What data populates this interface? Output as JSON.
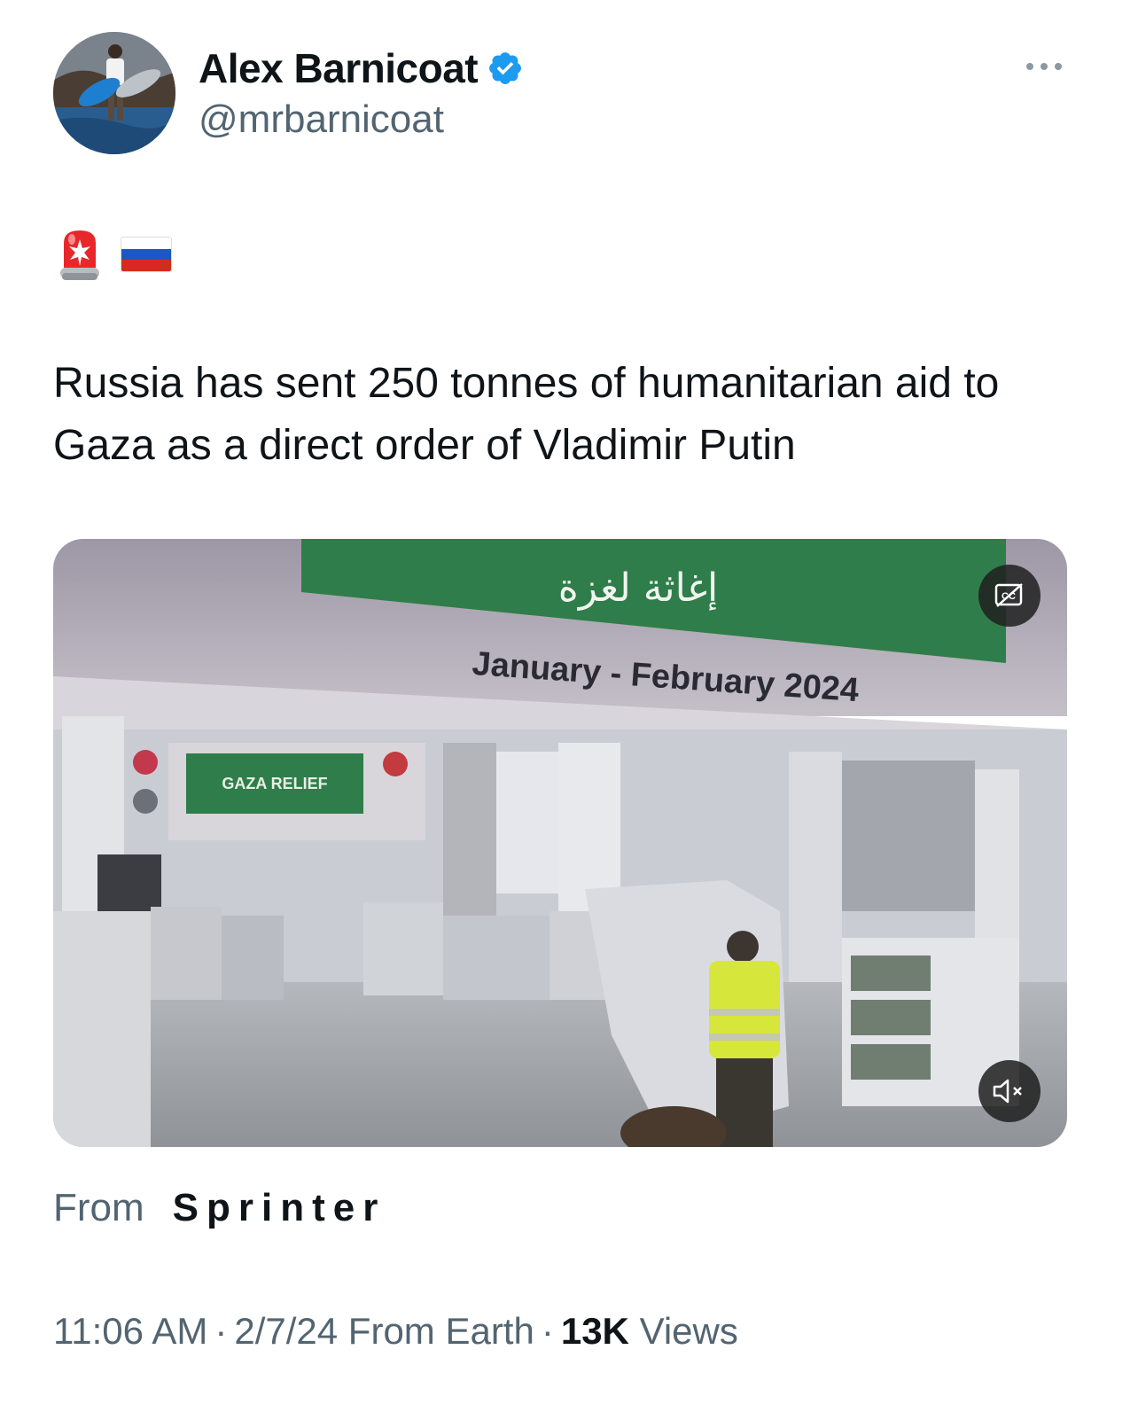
{
  "author": {
    "display_name": "Alex Barnicoat",
    "handle": "@mrbarnicoat",
    "verified": true,
    "avatar_icon": "avatar-surfer-photo"
  },
  "icons": {
    "more": "more-options-icon",
    "verified": "verified-badge-icon",
    "siren": "police-light-emoji",
    "flag": "russia-flag-emoji",
    "captions": "closed-captions-icon",
    "mute": "muted-speaker-icon"
  },
  "tweet": {
    "text": "Russia has sent 250 tonnes of humanitarian aid to Gaza as a direct order of Vladimir Putin"
  },
  "media": {
    "banner_arabic": "إغاثة لغزة",
    "banner_date": "January - February 2024",
    "sign_text": "GAZA RELIEF"
  },
  "source": {
    "prefix": "From",
    "name": "Sprinter"
  },
  "meta": {
    "time": "11:06 AM",
    "date": "2/7/24",
    "location": "From Earth",
    "views_count": "13K",
    "views_label": "Views",
    "separator": "·"
  },
  "colors": {
    "verified_blue": "#1d9bf0",
    "secondary_text": "#536471",
    "primary_text": "#0f1419"
  }
}
